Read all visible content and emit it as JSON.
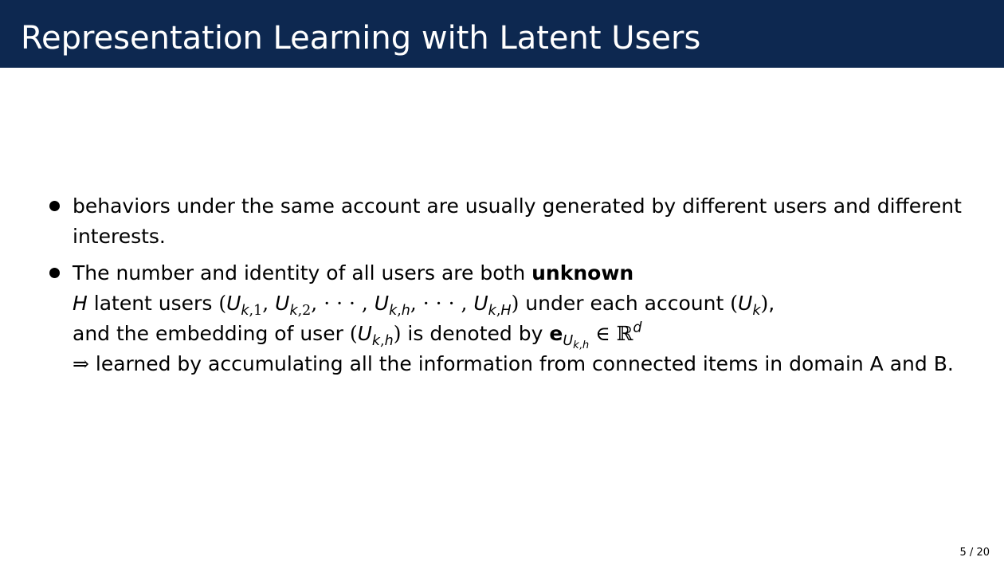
{
  "slide": {
    "title": "Representation Learning with Latent Users",
    "page_number": "5 / 20"
  },
  "bullets": {
    "b1": {
      "text": "behaviors under the same account are usually generated by different users and different interests."
    },
    "b2": {
      "line1_text": "The number and identity of all users are both ",
      "line1_bold": "unknown",
      "line2_H": "H",
      "line2_text_a": " latent users ",
      "line2_text_b": " under each account ",
      "line3_text_a": "and the embedding of user ",
      "line3_text_b": " is denoted by ",
      "line4_arrow": "⇒",
      "line4_text": " learned by accumulating all the information from connected items in domain A and B."
    }
  },
  "colors": {
    "header_bg": "#0d2850",
    "title_text": "#ffffff",
    "body_text": "#000000"
  }
}
